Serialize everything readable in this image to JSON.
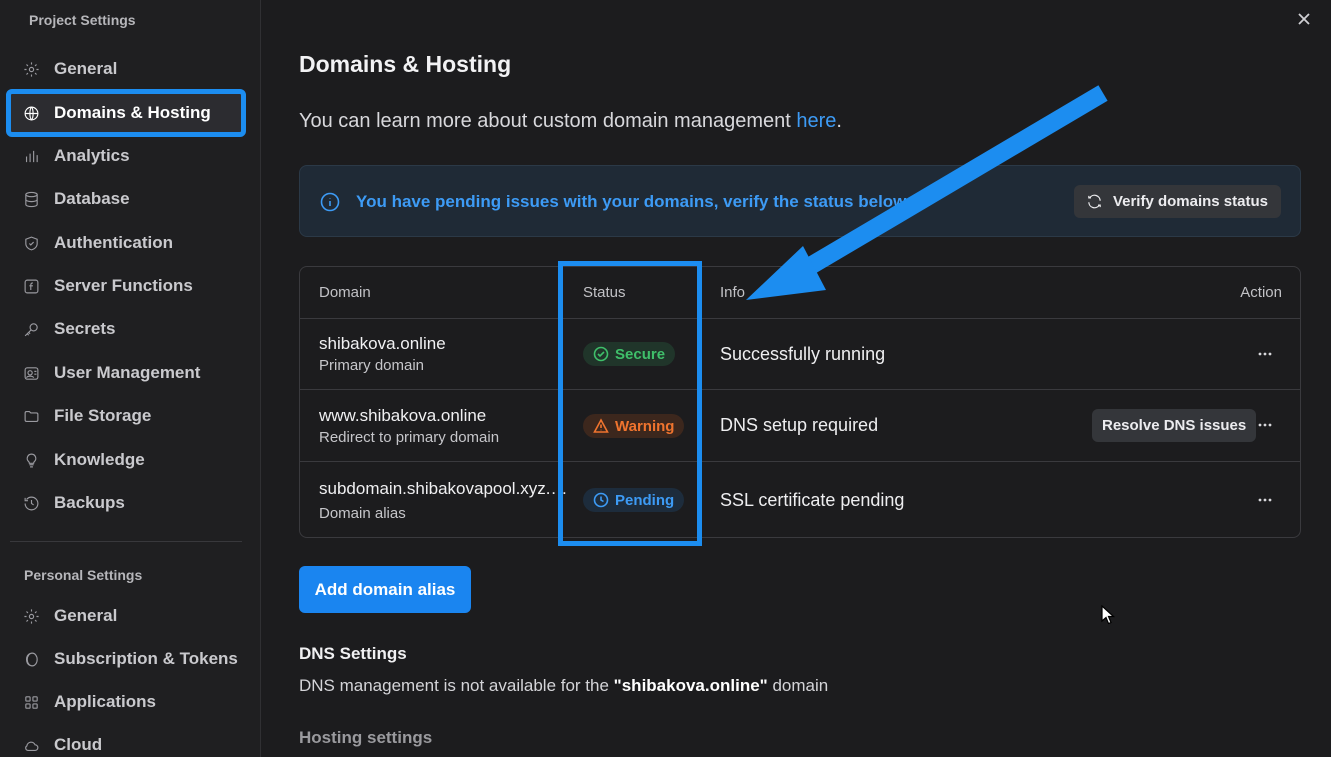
{
  "sidebar": {
    "project_title": "Project Settings",
    "project_items": [
      {
        "label": "General",
        "icon": "gear-icon"
      },
      {
        "label": "Domains & Hosting",
        "icon": "globe-icon",
        "active": true
      },
      {
        "label": "Analytics",
        "icon": "bar-chart-icon"
      },
      {
        "label": "Database",
        "icon": "database-icon"
      },
      {
        "label": "Authentication",
        "icon": "shield-icon"
      },
      {
        "label": "Server Functions",
        "icon": "function-icon"
      },
      {
        "label": "Secrets",
        "icon": "key-icon"
      },
      {
        "label": "User Management",
        "icon": "users-icon"
      },
      {
        "label": "File Storage",
        "icon": "folder-icon"
      },
      {
        "label": "Knowledge",
        "icon": "lightbulb-icon"
      },
      {
        "label": "Backups",
        "icon": "history-icon"
      }
    ],
    "personal_title": "Personal Settings",
    "personal_items": [
      {
        "label": "General",
        "icon": "gear-icon"
      },
      {
        "label": "Subscription & Tokens",
        "icon": "coin-icon"
      },
      {
        "label": "Applications",
        "icon": "apps-icon"
      },
      {
        "label": "Cloud",
        "icon": "cloud-icon"
      }
    ]
  },
  "main": {
    "title": "Domains & Hosting",
    "intro_text": "You can learn more about custom domain management ",
    "intro_link": "here",
    "intro_end": ".",
    "alert_text": "You have pending issues with your domains, verify the status below.",
    "verify_button": "Verify domains status",
    "table": {
      "headers": {
        "domain": "Domain",
        "status": "Status",
        "info": "Info",
        "action": "Action"
      },
      "rows": [
        {
          "domain": "shibakova.online",
          "subtitle": "Primary domain",
          "status": "Secure",
          "info": "Successfully running",
          "action_button": ""
        },
        {
          "domain": "www.shibakova.online",
          "subtitle": "Redirect to primary domain",
          "status": "Warning",
          "info": "DNS setup required",
          "action_button": "Resolve DNS issues"
        },
        {
          "domain": "subdomain.shibakovapool.xyz.com",
          "subtitle": "Domain alias",
          "status": "Pending",
          "info": "SSL certificate pending",
          "action_button": ""
        }
      ]
    },
    "add_alias_button": "Add domain alias",
    "dns_title": "DNS Settings",
    "dns_text_before": "DNS management is not available for the ",
    "dns_domain": "\"shibakova.online\"",
    "dns_text_after": " domain",
    "hosting_title": "Hosting settings"
  },
  "colors": {
    "accent": "#1a85f0",
    "link": "#3d9bf5",
    "secure": "#3fbf6a",
    "warning": "#f0742e",
    "pending": "#3d9bf5"
  }
}
